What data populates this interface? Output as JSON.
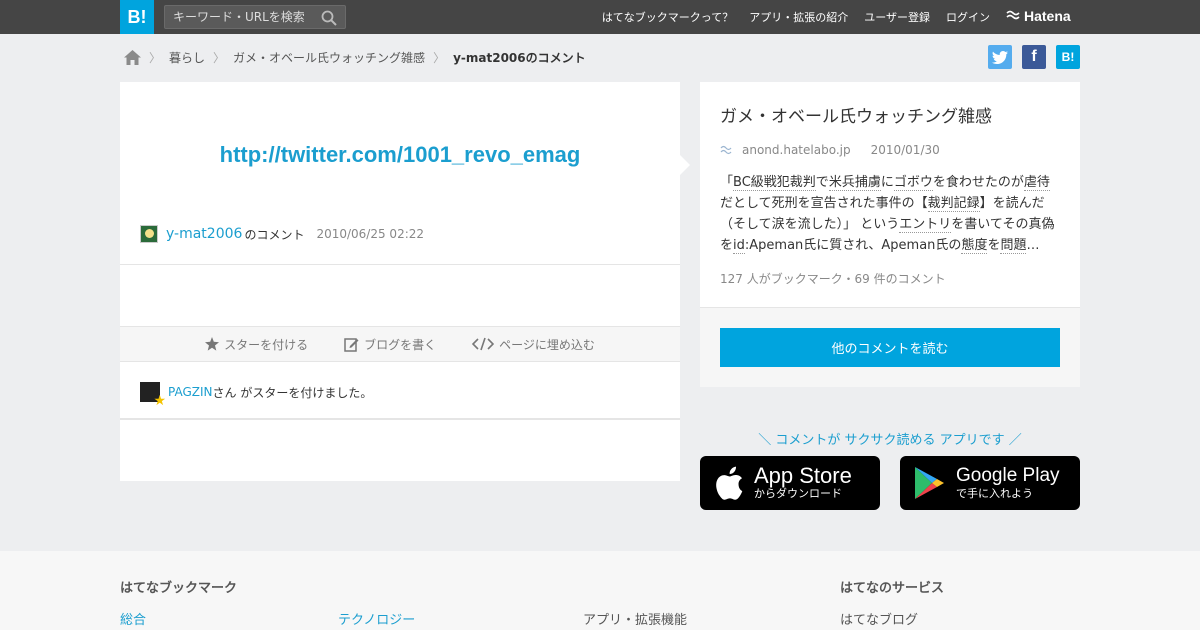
{
  "header": {
    "logo": "B!",
    "search_placeholder": "キーワード・URLを検索",
    "nav": [
      "はてなブックマークって？",
      "アプリ・拡張の紹介",
      "ユーザー登録",
      "ログイン"
    ],
    "brand": "Hatena"
  },
  "breadcrumb": {
    "items": [
      "暮らし",
      "ガメ・オベール氏ウォッチング雑感"
    ],
    "current": "y-mat2006のコメント"
  },
  "comment": {
    "link": "http://twitter.com/1001_revo_emag",
    "user": "y-mat2006",
    "suffix": "のコメント",
    "date": "2010/06/25 02:22",
    "actions": [
      "スターを付ける",
      "ブログを書く",
      "ページに埋め込む"
    ],
    "star_user": "PAGZIN",
    "star_text": "さん がスターを付けました。"
  },
  "entry": {
    "title": "ガメ・オベール氏ウォッチング雑感",
    "domain": "anond.hatelabo.jp",
    "date": "2010/01/30",
    "desc": {
      "p1": "「",
      "k1": "BC級戦犯裁判",
      "p2": "で",
      "k2": "米兵捕虜",
      "p3": "に",
      "k3": "ゴボウ",
      "p4": "を食わせたのが",
      "k4": "虐待",
      "p5": "だとして死刑を宣告された事件の【",
      "k5": "裁判記録",
      "p6": "】を読んだ（そして涙を流した）」 という",
      "k6": "エントリ",
      "p7": "を書いてその真偽を",
      "k7": "id",
      "p8": ":Apeman氏に質され、Apeman氏の",
      "k8": "態度",
      "p9": "を",
      "k9": "問題",
      "p10": "…"
    },
    "count": "127 人がブックマーク・69 件のコメント",
    "read_button": "他のコメントを読む"
  },
  "promo": {
    "text": "＼ コメントが サクサク読める アプリです ／",
    "appstore_big": "App Store",
    "appstore_small": "からダウンロード",
    "gplay_big": "Google Play",
    "gplay_small": "で手に入れよう"
  },
  "footer": {
    "heading1": "はてなブックマーク",
    "heading2": "はてなのサービス",
    "link1": "総合",
    "link2": "テクノロジー",
    "link3": "アプリ・拡張機能",
    "link4": "はてなブログ"
  },
  "colors": {
    "accent": "#00a4de",
    "link": "#1b9ecf",
    "topbar": "#454545"
  }
}
